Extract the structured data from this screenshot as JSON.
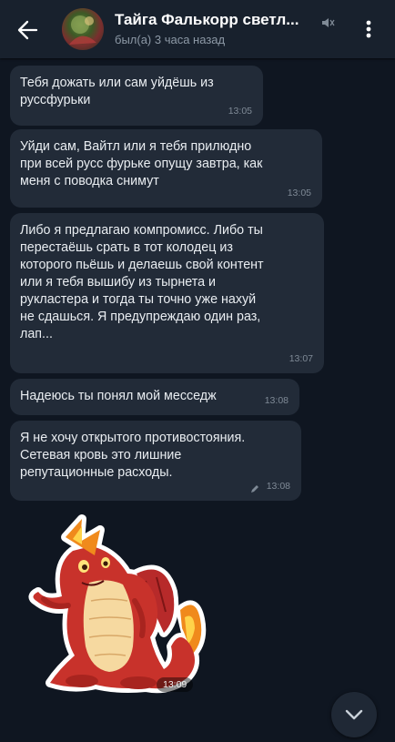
{
  "header": {
    "title": "Тайга Фалькорр светл...",
    "status": "был(а) 3 часа назад",
    "back_icon": "arrow-left-icon",
    "mute_icon": "mute-icon",
    "menu_icon": "kebab-menu-icon"
  },
  "messages": [
    {
      "text": "Тебя дожать или сам уйдёшь из\nруссфурьки",
      "time": "13:05",
      "edited": false
    },
    {
      "text": "Уйди сам, Вайтл или я тебя прилюдно\nпри всей русс фурьке опущу завтра, как\nменя с поводка снимут",
      "time": "13:05",
      "edited": false
    },
    {
      "text": "Либо я предлагаю компромисс. Либо ты\nперестаёшь срать в тот колодец из\nкоторого пьёшь и делаешь свой контент\nили я тебя вышибу из тырнета и\nрукластера и тогда ты точно уже нахуй\nне сдашься. Я предупреждаю один раз,\nлап...",
      "time": "13:07",
      "edited": false
    },
    {
      "text": "Надеюсь ты понял мой месседж",
      "time": "13:08",
      "edited": false
    },
    {
      "text": "Я не хочу открытого противостояния.\nСетевая кровь это лишние\nрепутационные расходы.",
      "time": "13:08",
      "edited": true
    }
  ],
  "sticker": {
    "description_icon": "red-dragon-sticker",
    "time": "13:09"
  },
  "colors": {
    "background": "#0f1621",
    "header": "#18212d",
    "bubble": "#222b38",
    "meta": "#7f8a96"
  }
}
